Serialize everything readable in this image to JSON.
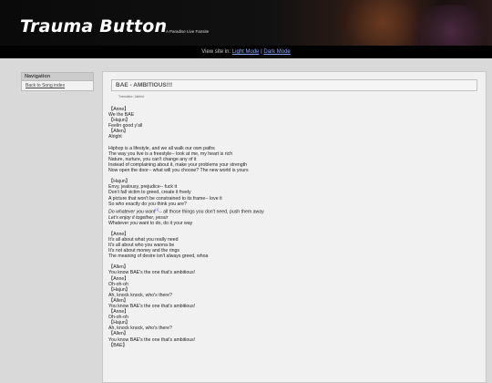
{
  "header": {
    "title": "Trauma Button",
    "subtitle": "A Paradise Live Fansite"
  },
  "modebar": {
    "prefix": "View site in: ",
    "light": "Light Mode",
    "sep": " | ",
    "dark": "Dark Mode"
  },
  "nav": {
    "heading": "Navigation",
    "items": [
      {
        "label": "Back to Song index"
      }
    ]
  },
  "song": {
    "title": "BAE - AMBITIOUS!!!",
    "translator": "Translator: Jabbid"
  },
  "lyrics": [
    {
      "t": "【Anne】"
    },
    {
      "t": "We the BAE"
    },
    {
      "t": "【Hajun】"
    },
    {
      "t": "Feelin good y'all"
    },
    {
      "t": "【Allen】"
    },
    {
      "t": "Alright"
    },
    {
      "t": ""
    },
    {
      "t": "Hiphop is a lifestyle, and we all walk our own paths"
    },
    {
      "t": "The way you live is a freestyle-- look at me, my heart is rich"
    },
    {
      "t": "Nature, nurture, you can't change any of it"
    },
    {
      "t": "Instead of complaining about it, make your problems your strength"
    },
    {
      "t": "Now open the door-- what will you choose? The new world is yours"
    },
    {
      "t": ""
    },
    {
      "t": "【Hajun】"
    },
    {
      "t": "Envy, jealousy, prejudice-- fuck it"
    },
    {
      "t": "Don't fall victim to greed, create it freely"
    },
    {
      "t": "A picture that won't be constrained to its frame-- love it"
    },
    {
      "t": "So who exactly do you think you are?"
    },
    {
      "t": "Do whatever you want",
      "em": true,
      "note": "[1]",
      "rest": "-- all those things you don't need, push them away"
    },
    {
      "t": "Let's enjoy it together, yessir",
      "em": true
    },
    {
      "t": "Whatever you want to do, do it your way"
    },
    {
      "t": ""
    },
    {
      "t": "【Anne】"
    },
    {
      "t": "It's all about what you really need"
    },
    {
      "t": "It's all about who you wanna be"
    },
    {
      "t": "It's not about money and the rings"
    },
    {
      "t": "The meaning of desire isn't always greed, whoa"
    },
    {
      "t": ""
    },
    {
      "t": "【Allen】"
    },
    {
      "t": "You know BAE's the one that's ambitious!"
    },
    {
      "t": "【Anne】"
    },
    {
      "t": "Oh-oh-oh"
    },
    {
      "t": "【Hajun】"
    },
    {
      "t": "Ah, knock knock, who's there?"
    },
    {
      "t": "【Allen】"
    },
    {
      "t": "You know BAE's the one that's ambitious!"
    },
    {
      "t": "【Anne】"
    },
    {
      "t": "Oh-oh-oh"
    },
    {
      "t": "【Hajun】"
    },
    {
      "t": "Ah, knock knock, who's there?"
    },
    {
      "t": "【Allen】"
    },
    {
      "t": "You know BAE's the one that's ambitious!"
    },
    {
      "t": "【BAE】"
    }
  ]
}
